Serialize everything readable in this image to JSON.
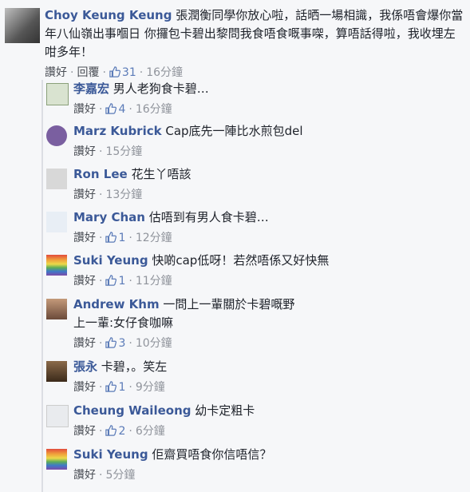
{
  "colors": {
    "link": "#3b5998",
    "text": "#1d2129",
    "meta": "#4b4f56",
    "time": "#90949c",
    "like": "#5b7bb8"
  },
  "main_comment": {
    "author": "Choy Keung Keung",
    "text": "張潤衡同學你放心啦，話晒一場相識，我係唔會爆你當年八仙嶺出事嗰日 你攞包卡碧出黎問我食唔食嘅事㗎，算唔話得啦，我收埋左咁多年！",
    "like_label": "讚好",
    "reply_label": "回覆",
    "like_count": "31",
    "time": "16分鐘",
    "sep": "·"
  },
  "replies": [
    {
      "author": "李嘉宏",
      "text": "男人老狗食卡碧…",
      "like_label": "讚好",
      "like_count": "4",
      "time": "16分鐘",
      "avatar": "li-avatar"
    },
    {
      "author": "Marz Kubrick",
      "text": "Cap底先一陣比水煎包del",
      "like_label": "讚好",
      "like_count": "",
      "time": "15分鐘",
      "avatar": "marz-avatar"
    },
    {
      "author": "Ron Lee",
      "text": "花生丫唔該",
      "like_label": "讚好",
      "like_count": "",
      "time": "13分鐘",
      "avatar": "ron-avatar"
    },
    {
      "author": "Mary Chan",
      "text": "估唔到有男人食卡碧…",
      "like_label": "讚好",
      "like_count": "1",
      "time": "12分鐘",
      "avatar": "mary-avatar"
    },
    {
      "author": "Suki Yeung",
      "text": "快啲cap低呀！若然唔係又好快無",
      "like_label": "讚好",
      "like_count": "1",
      "time": "11分鐘",
      "avatar": "suki-avatar"
    },
    {
      "author": "Andrew Khm",
      "text": "一問上一輩關於卡碧嘅野",
      "text2": "上一輩:女仔食咖嘛",
      "like_label": "讚好",
      "like_count": "3",
      "time": "10分鐘",
      "avatar": "andrew-avatar"
    },
    {
      "author": "張永",
      "text": "卡碧，。笑左",
      "like_label": "讚好",
      "like_count": "1",
      "time": "9分鐘",
      "avatar": "zhang-avatar"
    },
    {
      "author": "Cheung Waileong",
      "text": "幼卡定粗卡",
      "like_label": "讚好",
      "like_count": "2",
      "time": "6分鐘",
      "avatar": "cheung-avatar"
    },
    {
      "author": "Suki Yeung",
      "text": "佢齋買唔食你信唔信？",
      "like_label": "讚好",
      "like_count": "",
      "time": "5分鐘",
      "avatar": "suki-avatar"
    }
  ]
}
